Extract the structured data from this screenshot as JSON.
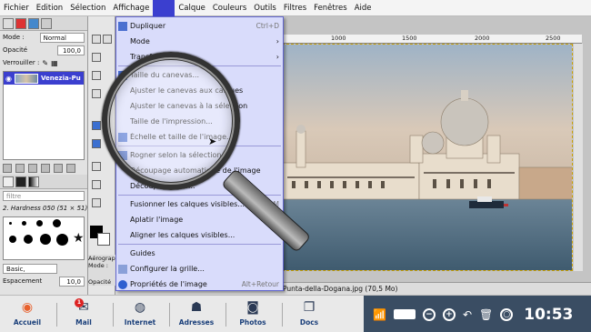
{
  "menubar": [
    "Fichier",
    "Edition",
    "Sélection",
    "Affichage",
    "Image",
    "Calque",
    "Couleurs",
    "Outils",
    "Filtres",
    "Fenêtres",
    "Aide"
  ],
  "layers_panel": {
    "mode_label": "Mode :",
    "mode_value": "Normal",
    "opacity_label": "Opacité",
    "opacity_value": "100,0",
    "lock_label": "Verrouiller :",
    "layer_name": "Venezia-Pu"
  },
  "brushes_panel": {
    "filter_placeholder": "filtre",
    "brush_name": "2. Hardness 050 (51 × 51)",
    "preset": "Basic,",
    "spacing_label": "Espacement",
    "spacing_value": "10,0"
  },
  "tool_options": {
    "title": "Aérograp",
    "mode_label": "Mode :",
    "opacity_label": "Opacité"
  },
  "ruler": {
    "marks": [
      "1000",
      "1500",
      "2000",
      "2500"
    ]
  },
  "status": {
    "filename": "Punta-della-Dogana.jpg (70,5 Mo)"
  },
  "image_menu": {
    "items": [
      {
        "label": "Dupliquer",
        "shortcut": "Ctrl+D",
        "submenu": false,
        "icon": true
      },
      {
        "label": "Mode",
        "shortcut": "",
        "submenu": true,
        "icon": false
      },
      {
        "label": "Transformer",
        "shortcut": "",
        "submenu": true,
        "icon": false
      },
      {
        "label": "Taille du canevas...",
        "shortcut": "",
        "submenu": false,
        "icon": true
      },
      {
        "label": "Ajuster le canevas aux calques",
        "shortcut": "",
        "submenu": false,
        "icon": false
      },
      {
        "label": "Ajuster le canevas à la sélection",
        "shortcut": "",
        "submenu": false,
        "icon": false
      },
      {
        "label": "Taille de l'impression...",
        "shortcut": "",
        "submenu": false,
        "icon": false
      },
      {
        "label": "Échelle et taille de l'image...",
        "shortcut": "",
        "submenu": false,
        "icon": true
      },
      {
        "label": "Rogner selon la sélection",
        "shortcut": "",
        "submenu": false,
        "icon": true
      },
      {
        "label": "Découpage automatique de l'image",
        "shortcut": "",
        "submenu": false,
        "icon": false
      },
      {
        "label": "Découpage futé...",
        "shortcut": "",
        "submenu": false,
        "icon": false
      },
      {
        "label": "Fusionner les calques visibles...",
        "shortcut": "Ctrl+M",
        "submenu": false,
        "icon": false
      },
      {
        "label": "Aplatir l'image",
        "shortcut": "",
        "submenu": false,
        "icon": false
      },
      {
        "label": "Aligner les calques visibles...",
        "shortcut": "",
        "submenu": false,
        "icon": false
      },
      {
        "label": "Guides",
        "shortcut": "",
        "submenu": true,
        "icon": false
      },
      {
        "label": "Configurer la grille...",
        "shortcut": "",
        "submenu": false,
        "icon": true
      },
      {
        "label": "Propriétés de l'image",
        "shortcut": "Alt+Retour",
        "submenu": false,
        "icon": true
      }
    ]
  },
  "taskbar": {
    "apps": [
      {
        "label": "Accueil",
        "icon": "home-icon",
        "glyph": "◉"
      },
      {
        "label": "Mail",
        "icon": "mail-icon",
        "glyph": "✉"
      },
      {
        "label": "Internet",
        "icon": "globe-icon",
        "glyph": "◍"
      },
      {
        "label": "Adresses",
        "icon": "contacts-icon",
        "glyph": "☗"
      },
      {
        "label": "Photos",
        "icon": "camera-icon",
        "glyph": "◙"
      },
      {
        "label": "Docs",
        "icon": "documents-icon",
        "glyph": "❐"
      }
    ],
    "mail_badge": "1",
    "clock": "10:53"
  },
  "colors": {
    "accent": "#3b3fcf",
    "menu_bg": "#d9dcfb",
    "tray_bg": "#3a4d63"
  }
}
